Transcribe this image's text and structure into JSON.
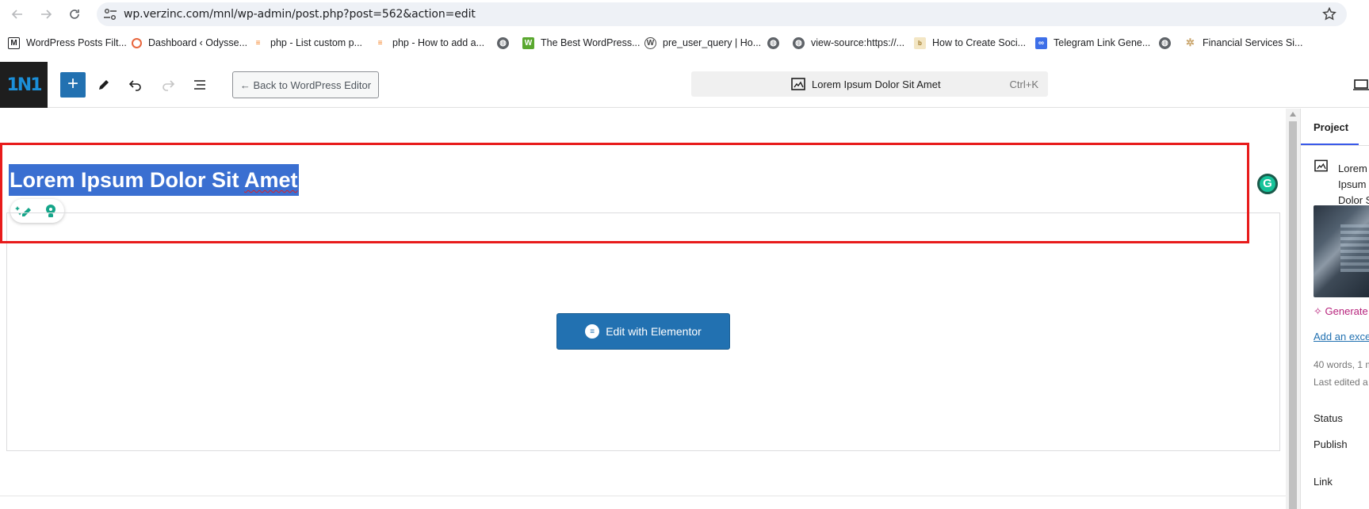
{
  "browser": {
    "url": "wp.verzinc.com/mnl/wp-admin/post.php?post=562&action=edit",
    "bookmarks": [
      {
        "label": "WordPress Posts Filt...",
        "icon": "m-icon"
      },
      {
        "label": "Dashboard ‹ Odysse...",
        "icon": "dashboard-icon"
      },
      {
        "label": "php - List custom p...",
        "icon": "stackoverflow-icon"
      },
      {
        "label": "php - How to add a...",
        "icon": "stackoverflow-icon"
      },
      {
        "label": "",
        "icon": "globe-icon"
      },
      {
        "label": "The Best WordPress...",
        "icon": "w-icon"
      },
      {
        "label": "pre_user_query | Ho...",
        "icon": "wordpress-icon"
      },
      {
        "label": "",
        "icon": "globe-icon"
      },
      {
        "label": "view-source:https://...",
        "icon": "globe-icon"
      },
      {
        "label": "How to Create Soci...",
        "icon": "blog-icon"
      },
      {
        "label": "Telegram Link Gene...",
        "icon": "link-icon"
      },
      {
        "label": "",
        "icon": "globe-icon"
      },
      {
        "label": "Financial Services Si...",
        "icon": "gear-icon"
      }
    ]
  },
  "editor": {
    "logo_text": "1N1",
    "back_button": "← Back to WordPress Editor",
    "command_title": "Lorem Ipsum Dolor Sit Amet",
    "command_shortcut": "Ctrl+K"
  },
  "post": {
    "title_prefix": "Lorem Ipsum Dolor Sit ",
    "title_last": "Amet",
    "elementor_button": "Edit with Elementor"
  },
  "sidebar": {
    "tab": "Project",
    "doc_title": "Lorem Ipsum Dolor Sit Amet",
    "generate": "Generate",
    "excerpt_link": "Add an excerpt",
    "meta_words": "40 words, 1 m",
    "meta_edited": "Last edited a",
    "status_label": "Status",
    "status_value": "Publish",
    "link_label": "Link"
  },
  "colors": {
    "accent": "#2271b1",
    "highlight_border": "#e81b1b",
    "title_selection": "#3a6fd1"
  }
}
